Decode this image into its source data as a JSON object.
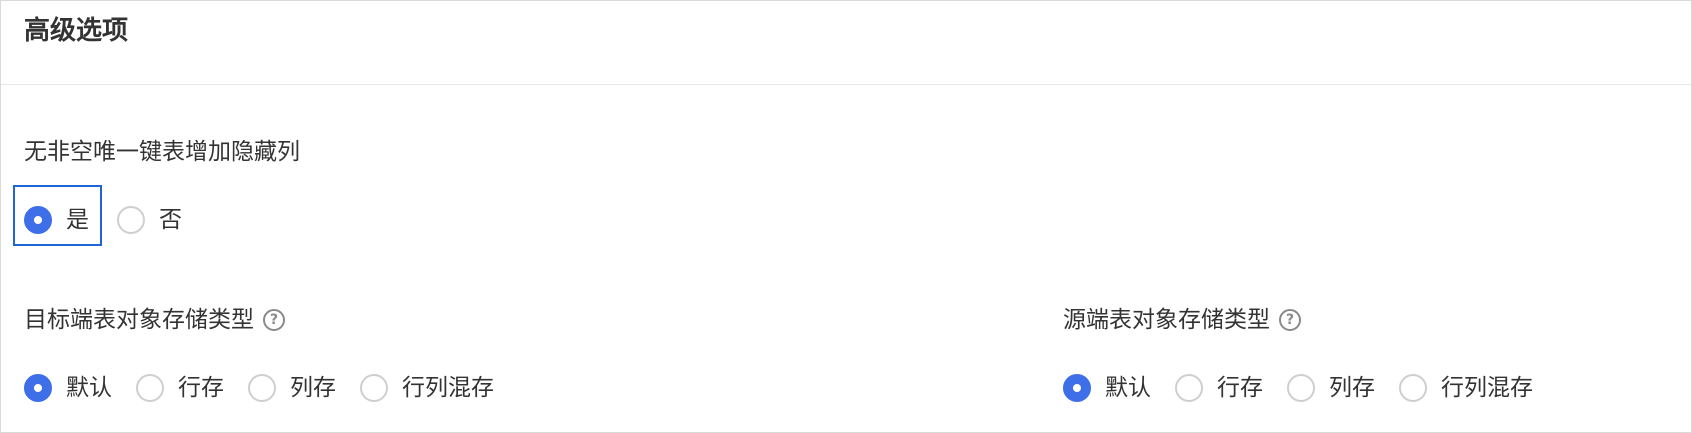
{
  "panel": {
    "title": "高级选项"
  },
  "hidden_column": {
    "label": "无非空唯一键表增加隐藏列",
    "options": [
      {
        "label": "是",
        "checked": true
      },
      {
        "label": "否",
        "checked": false
      }
    ]
  },
  "target_storage": {
    "label": "目标端表对象存储类型",
    "help": "?",
    "options": [
      {
        "label": "默认",
        "checked": true
      },
      {
        "label": "行存",
        "checked": false
      },
      {
        "label": "列存",
        "checked": false
      },
      {
        "label": "行列混存",
        "checked": false
      }
    ]
  },
  "source_storage": {
    "label": "源端表对象存储类型",
    "help": "?",
    "options": [
      {
        "label": "默认",
        "checked": true
      },
      {
        "label": "行存",
        "checked": false
      },
      {
        "label": "列存",
        "checked": false
      },
      {
        "label": "行列混存",
        "checked": false
      }
    ]
  },
  "colors": {
    "accent": "#3f6fe8",
    "focus_outline": "#1e66d8",
    "text": "#333333",
    "border": "#d9d9d9"
  }
}
